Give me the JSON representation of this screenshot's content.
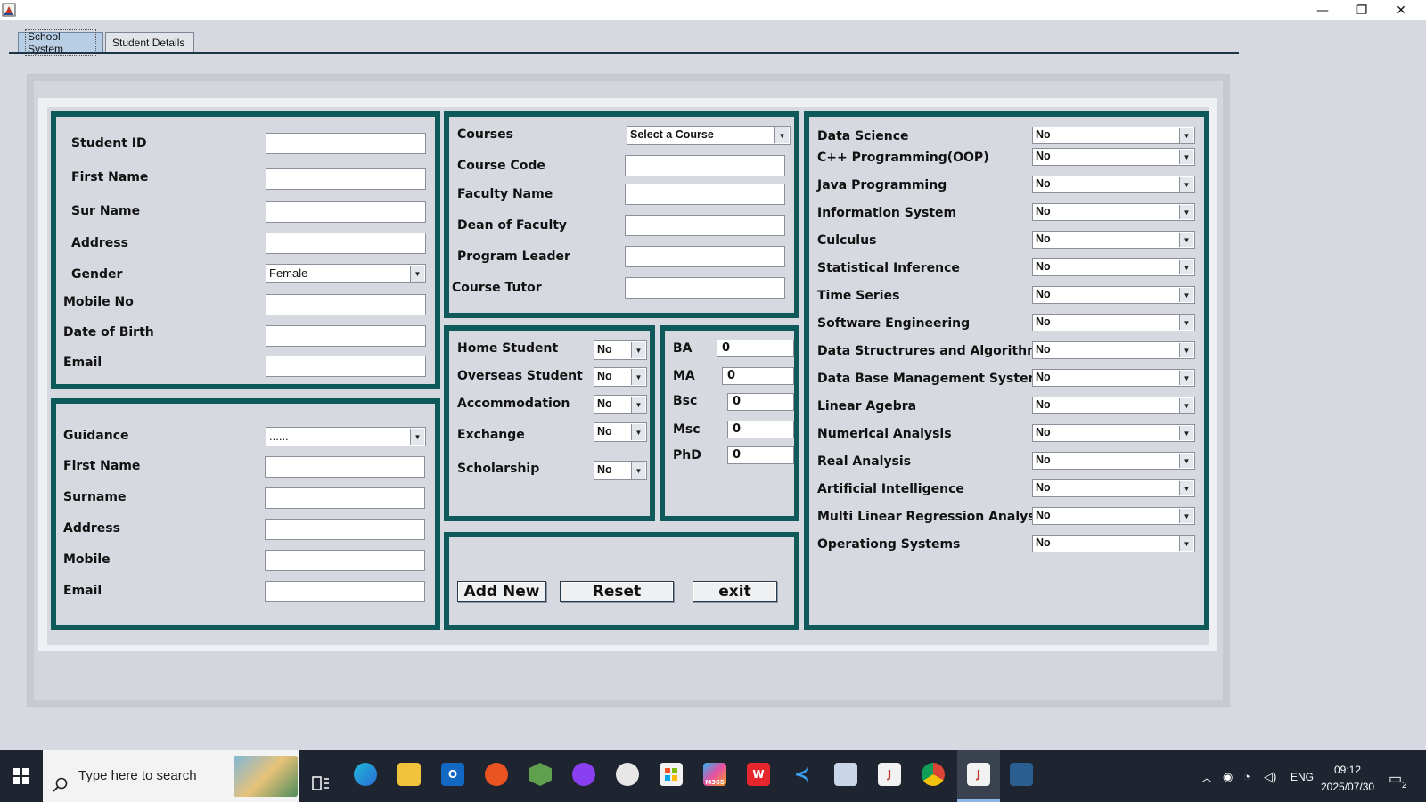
{
  "window": {
    "controls": {
      "minimize": "—",
      "restore": "❐",
      "close": "✕"
    }
  },
  "tabs": [
    {
      "label": "School System",
      "selected": true
    },
    {
      "label": "Student Details",
      "selected": false
    }
  ],
  "student_panel": {
    "student_id": {
      "label": "Student ID",
      "value": ""
    },
    "first_name": {
      "label": "First Name",
      "value": ""
    },
    "sur_name": {
      "label": "Sur Name",
      "value": ""
    },
    "address": {
      "label": "Address",
      "value": ""
    },
    "gender": {
      "label": "Gender",
      "value": "Female"
    },
    "mobile": {
      "label": "Mobile No",
      "value": ""
    },
    "dob": {
      "label": "Date of Birth",
      "value": ""
    },
    "email": {
      "label": "Email",
      "value": ""
    }
  },
  "guidance_panel": {
    "guidance": {
      "label": "Guidance",
      "value": "......"
    },
    "first_name": {
      "label": "First Name",
      "value": ""
    },
    "surname": {
      "label": "Surname",
      "value": ""
    },
    "address": {
      "label": "Address",
      "value": ""
    },
    "mobile": {
      "label": "Mobile",
      "value": ""
    },
    "email": {
      "label": "Email",
      "value": ""
    }
  },
  "course_panel": {
    "courses": {
      "label": "Courses",
      "value": "Select a Course"
    },
    "course_code": {
      "label": "Course Code",
      "value": ""
    },
    "faculty_name": {
      "label": "Faculty Name",
      "value": ""
    },
    "dean": {
      "label": "Dean of Faculty",
      "value": ""
    },
    "program_leader": {
      "label": "Program Leader",
      "value": ""
    },
    "course_tutor": {
      "label": "Course Tutor",
      "value": ""
    }
  },
  "status_panel": {
    "home_student": {
      "label": "Home Student",
      "value": "No"
    },
    "overseas_student": {
      "label": "Overseas Student",
      "value": "No"
    },
    "accommodation": {
      "label": "Accommodation",
      "value": "No"
    },
    "exchange": {
      "label": "Exchange",
      "value": "No"
    },
    "scholarship": {
      "label": "Scholarship",
      "value": "No"
    }
  },
  "degree_panel": {
    "ba": {
      "label": "BA",
      "value": "0"
    },
    "ma": {
      "label": "MA",
      "value": "0"
    },
    "bsc": {
      "label": "Bsc",
      "value": "0"
    },
    "msc": {
      "label": "Msc",
      "value": "0"
    },
    "phd": {
      "label": "PhD",
      "value": "0"
    }
  },
  "actions": {
    "add_new": "Add New",
    "reset": "Reset",
    "exit": "exit"
  },
  "subjects": [
    {
      "label": "Data Science",
      "value": "No"
    },
    {
      "label": "C++ Programming(OOP)",
      "value": "No"
    },
    {
      "label": "Java Programming",
      "value": "No"
    },
    {
      "label": "Information System",
      "value": "No"
    },
    {
      "label": "Culculus",
      "value": "No"
    },
    {
      "label": "Statistical Inference",
      "value": "No"
    },
    {
      "label": "Time Series",
      "value": "No"
    },
    {
      "label": "Software Engineering",
      "value": "No"
    },
    {
      "label": "Data Structrures and Algorithms",
      "value": "No"
    },
    {
      "label": "Data Base Management Systems",
      "value": "No"
    },
    {
      "label": "Linear Agebra",
      "value": "No"
    },
    {
      "label": "Numerical Analysis",
      "value": "No"
    },
    {
      "label": "Real Analysis",
      "value": "No"
    },
    {
      "label": "Artificial Intelligence",
      "value": "No"
    },
    {
      "label": "Multi Linear Regression Analysis",
      "value": "No"
    },
    {
      "label": "Operationg Systems",
      "value": "No"
    }
  ],
  "taskbar": {
    "search_placeholder": "Type here to search",
    "apps": [
      "edge-icon",
      "file-explorer-icon",
      "outlook-icon",
      "ubuntu-icon",
      "node-icon",
      "podcast-icon",
      "paint-icon",
      "store-icon",
      "m365-icon",
      "wps-icon",
      "vscode-icon",
      "box-icon",
      "java-icon",
      "chrome-icon",
      "java-app-icon",
      "mysql-icon"
    ],
    "m365_label": "M365",
    "language": "ENG",
    "time": "09:12",
    "date": "2025/07/30",
    "notification_count": "2"
  }
}
